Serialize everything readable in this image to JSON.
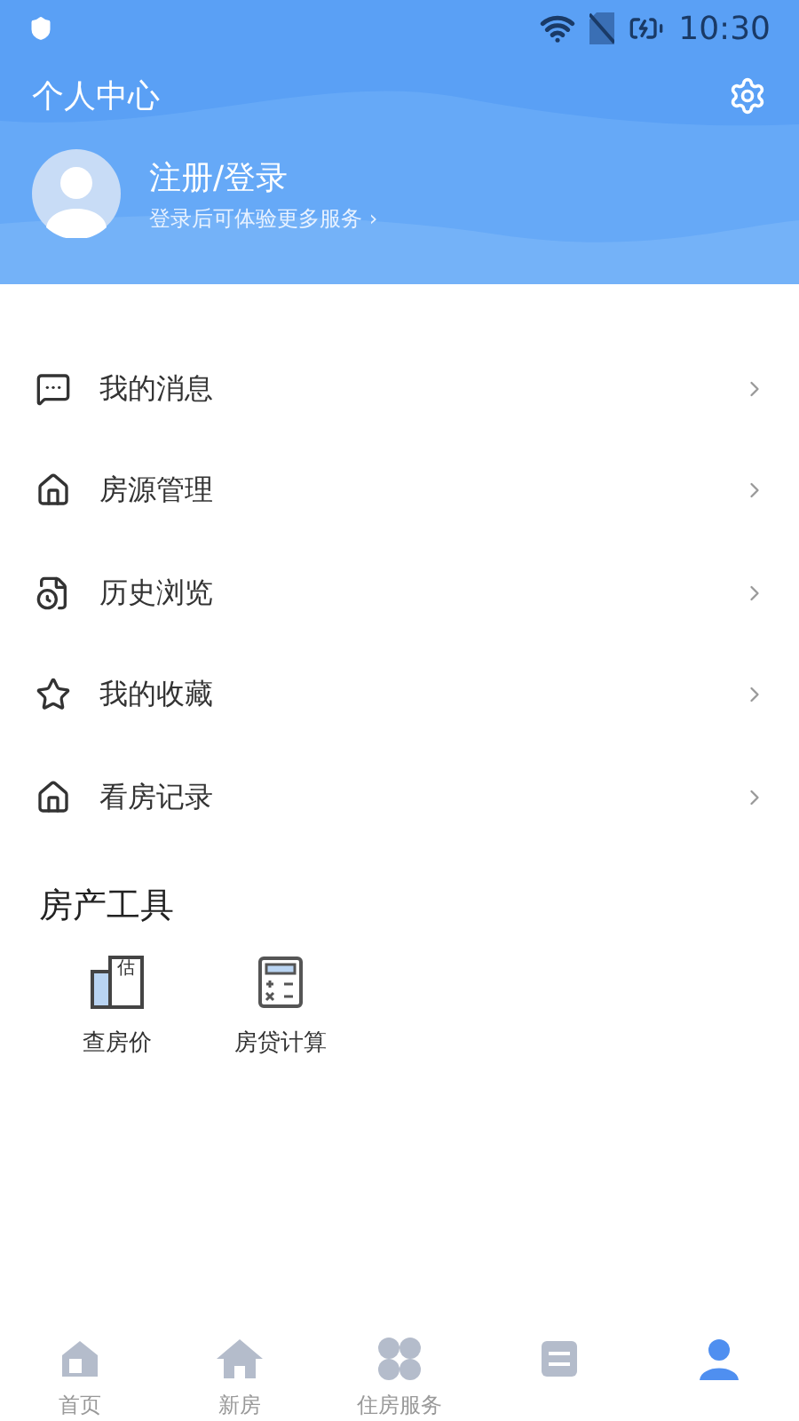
{
  "status_bar": {
    "time": "10:30"
  },
  "header": {
    "title": "个人中心",
    "user": {
      "name": "注册/登录",
      "hint": "登录后可体验更多服务 ›"
    }
  },
  "menu": [
    {
      "kind": "message",
      "label": "我的消息"
    },
    {
      "kind": "house",
      "label": "房源管理"
    },
    {
      "kind": "history",
      "label": "历史浏览"
    },
    {
      "kind": "star",
      "label": "我的收藏"
    },
    {
      "kind": "home",
      "label": "看房记录"
    }
  ],
  "tools": {
    "title": "房产工具",
    "items": [
      {
        "kind": "estimate",
        "label": "查房价",
        "badge": "估"
      },
      {
        "kind": "calculator",
        "label": "房贷计算"
      }
    ]
  },
  "nav": [
    {
      "kind": "home",
      "label": "首页",
      "selected": false
    },
    {
      "kind": "house",
      "label": "新房",
      "selected": false
    },
    {
      "kind": "clover",
      "label": "住房服务",
      "selected": false
    },
    {
      "kind": "list",
      "selected": false
    },
    {
      "kind": "person",
      "selected": true
    }
  ]
}
